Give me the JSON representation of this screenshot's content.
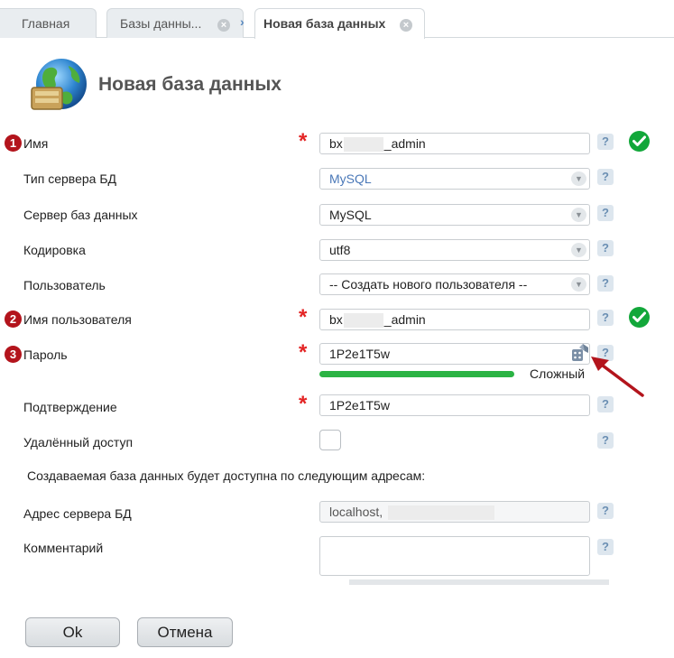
{
  "tabs": [
    {
      "label": "Главная",
      "closable": false,
      "active": false
    },
    {
      "label": "Базы данны...",
      "closable": true,
      "active": false
    },
    {
      "label": "Новая база данных",
      "closable": true,
      "active": true
    }
  ],
  "page": {
    "title": "Новая база данных",
    "icon": "globe-database-icon"
  },
  "steps": [
    "1",
    "2",
    "3"
  ],
  "form": {
    "name": {
      "label": "Имя",
      "prefix": "bx",
      "suffix": "_admin",
      "required": true,
      "valid": true
    },
    "server_type": {
      "label": "Тип сервера БД",
      "value": "MySQL"
    },
    "db_server": {
      "label": "Сервер баз данных",
      "value": "MySQL"
    },
    "encoding": {
      "label": "Кодировка",
      "value": "utf8"
    },
    "user": {
      "label": "Пользователь",
      "value": "-- Создать нового пользователя --"
    },
    "username": {
      "label": "Имя пользователя",
      "prefix": "bx",
      "suffix": "_admin",
      "required": true,
      "valid": true
    },
    "password": {
      "label": "Пароль",
      "value": "1P2e1T5w",
      "required": true,
      "strength_label": "Сложный",
      "strength": 1.0
    },
    "confirm": {
      "label": "Подтверждение",
      "value": "1P2e1T5w",
      "required": true
    },
    "remote_access": {
      "label": "Удалённый доступ",
      "checked": false
    },
    "info": "Создаваемая база данных будет доступна по следующим адресам:",
    "server_address": {
      "label": "Адрес сервера БД",
      "value": "localhost,"
    },
    "comment": {
      "label": "Комментарий",
      "value": ""
    }
  },
  "help_glyph": "?",
  "required_glyph": "*",
  "buttons": {
    "ok": "Ok",
    "cancel": "Отмена"
  },
  "colors": {
    "required": "#e32424",
    "valid": "#12a73a",
    "badge": "#b3141c",
    "strength": "#2bb344",
    "arrow": "#b3141c"
  }
}
